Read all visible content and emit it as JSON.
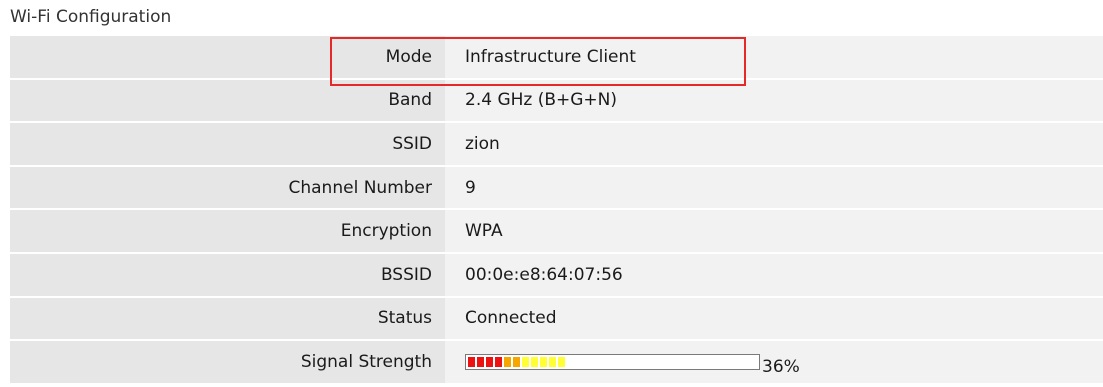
{
  "section_title": "Wi-Fi Configuration",
  "rows": [
    {
      "label": "Mode",
      "value": "Infrastructure Client"
    },
    {
      "label": "Band",
      "value": "2.4 GHz (B+G+N)"
    },
    {
      "label": "SSID",
      "value": "zion"
    },
    {
      "label": "Channel Number",
      "value": "9"
    },
    {
      "label": "Encryption",
      "value": "WPA"
    },
    {
      "label": "BSSID",
      "value": "00:0e:e8:64:07:56"
    },
    {
      "label": "Status",
      "value": "Connected"
    }
  ],
  "signal": {
    "label": "Signal Strength",
    "value_text": "36%",
    "percent": 36,
    "colors": {
      "red": "#ee1111",
      "orange": "#f7a600",
      "yellow": "#ffff33"
    }
  },
  "highlight_color": "#e52929"
}
